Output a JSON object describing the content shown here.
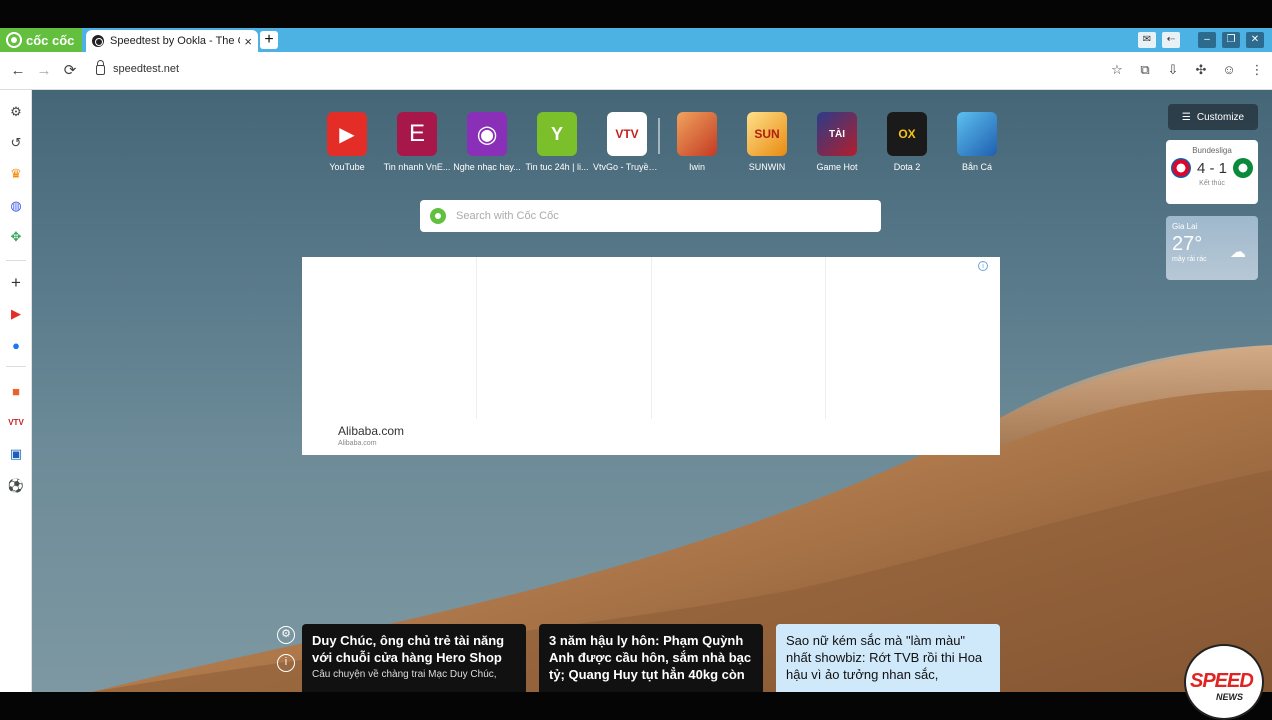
{
  "browser": {
    "brand": "cốc cốc",
    "tab_title": "Speedtest by Ookla - The Gl",
    "tab_close": "×",
    "new_tab": "+",
    "url": "speedtest.net"
  },
  "nav": {
    "back": "←",
    "forward": "→",
    "reload": "⟳"
  },
  "shortcuts": [
    {
      "label": "YouTube",
      "color": "#e52d27",
      "glyph": "▶"
    },
    {
      "label": "Tin nhanh VnE...",
      "color": "#a8174a",
      "glyph": "E"
    },
    {
      "label": "Nghe nhạc hay...",
      "color": "#8a2fb8",
      "glyph": "◉"
    },
    {
      "label": "Tin tuc 24h | li...",
      "color": "#7bbf2a",
      "glyph": "Y"
    },
    {
      "label": "VtvGo - Truyền...",
      "color": "#ffffff",
      "glyph": "VTV"
    },
    {
      "label": "Iwin",
      "color": "#d9442a",
      "glyph": ""
    },
    {
      "label": "SUNWIN",
      "color": "#f1a11c",
      "glyph": "SUN"
    },
    {
      "label": "Game Hot",
      "color": "#1c2b6e",
      "glyph": "TÀI"
    },
    {
      "label": "Dota 2",
      "color": "#1a1a1a",
      "glyph": "OX"
    },
    {
      "label": "Bắn Cá",
      "color": "#2d86d8",
      "glyph": ""
    }
  ],
  "search": {
    "placeholder": "Search with Cốc Cốc"
  },
  "ad": {
    "brand": "Alibaba.com",
    "sub": "Alibaba.com",
    "info": "i"
  },
  "widgets": {
    "customize": "Customize",
    "score": {
      "league": "Bundesliga",
      "result": "4 - 1",
      "status": "Kết thúc"
    },
    "weather": {
      "location": "Gia Lai",
      "temp": "27°",
      "desc": "mây rải rác"
    }
  },
  "news": [
    {
      "title": "Duy Chúc, ông chủ trẻ tài năng với chuỗi cửa hàng Hero Shop",
      "desc": "Câu chuyện về chàng trai Mạc Duy Chúc,"
    },
    {
      "title": "3 năm hậu ly hôn: Phạm Quỳnh Anh được cầu hôn, sắm nhà bạc tỷ; Quang Huy tụt hẳn 40kg còn",
      "desc": ""
    },
    {
      "title": "Sao nữ kém sắc mà \"làm màu\" nhất showbiz: Rớt TVB rồi thi Hoa hậu vì ảo tưởng nhan sắc,",
      "desc": ""
    }
  ],
  "stamp": {
    "title": "SPEED",
    "sub": "NEWS"
  }
}
